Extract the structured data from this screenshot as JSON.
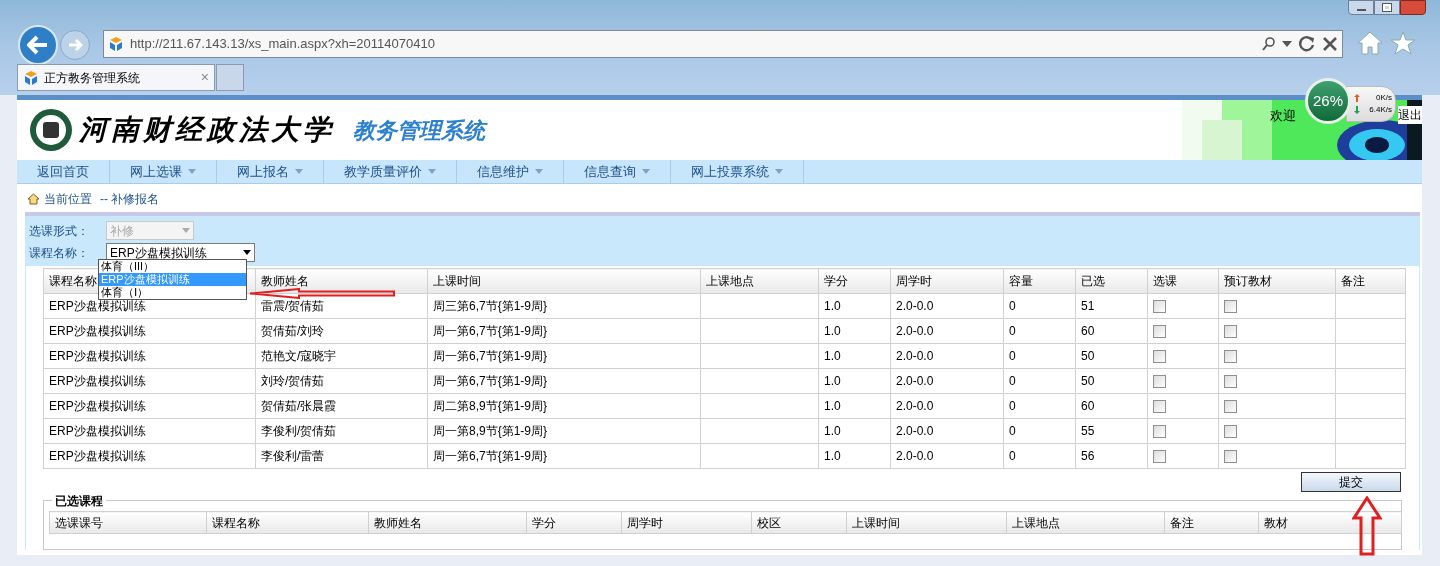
{
  "browser": {
    "url": "http://211.67.143.13/xs_main.aspx?xh=20114070410",
    "tab_title": "正方教务管理系统",
    "tab_close": "×"
  },
  "net_meter": {
    "percent": "26%",
    "up": "0K/s",
    "down": "6.4K/s"
  },
  "header": {
    "school": "河南财经政法大学",
    "system": "教务管理系统",
    "welcome": "欢迎",
    "logout": "退出"
  },
  "nav": [
    {
      "label": "返回首页",
      "dropdown": false
    },
    {
      "label": "网上选课",
      "dropdown": true
    },
    {
      "label": "网上报名",
      "dropdown": true
    },
    {
      "label": "教学质量评价",
      "dropdown": true
    },
    {
      "label": "信息维护",
      "dropdown": true
    },
    {
      "label": "信息查询",
      "dropdown": true
    },
    {
      "label": "网上投票系统",
      "dropdown": true
    }
  ],
  "breadcrumb": {
    "label": "当前位置",
    "path": "-- 补修报名"
  },
  "form": {
    "type_label": "选课形式：",
    "type_value": "补修",
    "type_disabled": true,
    "course_label": "课程名称：",
    "course_value": "ERP沙盘模拟训练"
  },
  "dropdown_options": [
    {
      "label": "体育（III）",
      "selected": false
    },
    {
      "label": "ERP沙盘模拟训练",
      "selected": true
    },
    {
      "label": "体育（Ⅰ）",
      "selected": false
    }
  ],
  "table": {
    "columns": [
      "课程名称",
      "教师姓名",
      "上课时间",
      "上课地点",
      "学分",
      "周学时",
      "容量",
      "已选",
      "选课",
      "预订教材",
      "备注"
    ],
    "rows": [
      {
        "course": "ERP沙盘模拟训练",
        "teacher": "雷震/贺倩茹",
        "time": "周三第6,7节{第1-9周}",
        "credit": "1.0",
        "hours": "2.0-0.0",
        "capacity": "0",
        "chosen": "51",
        "select": false,
        "book": false
      },
      {
        "course": "ERP沙盘模拟训练",
        "teacher": "贺倩茹/刘玲",
        "time": "周一第6,7节{第1-9周}",
        "credit": "1.0",
        "hours": "2.0-0.0",
        "capacity": "0",
        "chosen": "60",
        "select": false,
        "book": false
      },
      {
        "course": "ERP沙盘模拟训练",
        "teacher": "范艳文/寇晓宇",
        "time": "周一第6,7节{第1-9周}",
        "credit": "1.0",
        "hours": "2.0-0.0",
        "capacity": "0",
        "chosen": "50",
        "select": false,
        "book": false
      },
      {
        "course": "ERP沙盘模拟训练",
        "teacher": "刘玲/贺倩茹",
        "time": "周一第6,7节{第1-9周}",
        "credit": "1.0",
        "hours": "2.0-0.0",
        "capacity": "0",
        "chosen": "50",
        "select": false,
        "book": false
      },
      {
        "course": "ERP沙盘模拟训练",
        "teacher": "贺倩茹/张晨霞",
        "time": "周二第8,9节{第1-9周}",
        "credit": "1.0",
        "hours": "2.0-0.0",
        "capacity": "0",
        "chosen": "60",
        "select": false,
        "book": false
      },
      {
        "course": "ERP沙盘模拟训练",
        "teacher": "李俊利/贺倩茹",
        "time": "周一第8,9节{第1-9周}",
        "credit": "1.0",
        "hours": "2.0-0.0",
        "capacity": "0",
        "chosen": "55",
        "select": false,
        "book": false
      },
      {
        "course": "ERP沙盘模拟训练",
        "teacher": "李俊利/雷蕾",
        "time": "周一第6,7节{第1-9周}",
        "credit": "1.0",
        "hours": "2.0-0.0",
        "capacity": "0",
        "chosen": "56",
        "select": false,
        "book": false
      }
    ]
  },
  "submit": "提交",
  "selected_courses": {
    "title": "已选课程",
    "columns": [
      "选课课号",
      "课程名称",
      "教师姓名",
      "学分",
      "周学时",
      "校区",
      "上课时间",
      "上课地点",
      "备注",
      "教材"
    ]
  }
}
